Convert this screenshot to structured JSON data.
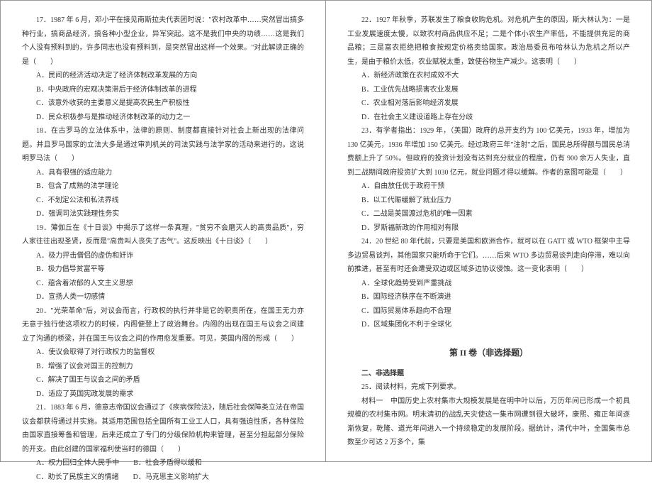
{
  "left": {
    "q17": {
      "stem": "17．1987 年 6 月，邓小平在接见南斯拉夫代表团时说：\"农村改革中……突然冒出搞多种行业，搞商品经济，搞各种小型企业，异军突起。这不是我们中央的功绩……这是我们个人没有预料到的，许多同志也没有预料到，是突然冒出这样一个效果。\"对此解读正确的是（　　）",
      "A": "A．民间的经济活动决定了经济体制改革发展的方向",
      "B": "B．中央政府的宏观决策滞后于经济体制改革的进程",
      "C": "C．该意外收获的主要意义是提高农民生产积极性",
      "D": "D．民众积极参与是推动经济体制改革的动力之一"
    },
    "q18": {
      "stem": "18．在古罗马的立法体系中，法律的原则、制度都直接针对社会上新出现的法律问题。并且罗马国家的立法大多是通过审判机关的司法实践与法学家的活动来进行的。这说明罗马法（　　）",
      "A": "A．具有很强的适应能力",
      "B": "B．包含了成熟的法学理论",
      "C": "C．不划定公法和私法界线",
      "D": "D．强调司法实践理性务实"
    },
    "q19": {
      "stem": "19．薄伽丘在《十日谈》中揭示了这样一条真理，\"贫穷不会磨灭人的高贵品质\"，穷人家往往出现圣贤，反而是\"高贵叫人丧失了志气\"。这反映出《十日谈》（　　）",
      "A": "A．极力抨击僧侣的虚伪和奸诈",
      "B": "B．极力倡导贫富平等",
      "C": "C．蕴含着浓郁的人文主义思想",
      "D": "D．宣扬人类一切感情"
    },
    "q20": {
      "stem": "20．\"光荣革命\"后，对议会而言，行政权的执行并非是它的职责所在，在国王无力亦无意于独行使这项权力的时候，内阁便登上了政治舞台。内阁的出现在国王与议会之间建立了沟通的桥梁，并在国王与议会之间的作用愈发重要。可见，英国内阁的形成（　　）",
      "A": "A．使议会取得了对行政权力的监督权",
      "B": "B．增强了议会对国王的控制力",
      "C": "C．解决了国王与议会之间的矛盾",
      "D": "D．适应了英国宪政发展的需求"
    },
    "q21": {
      "stem": "21．1883 年 6 月，德意志帝国议会通过了《疾病保险法》，随后社会保障类立法在帝国议会都获得通过并实施。其适用范围包括全国所有工业工人口，具有强迫性质，各种保险由国家直接筹备和管理，后来还成立了专门的分级保险机构来管理，甚至分担起部分保险的开支。由此创建的国家福利使当时的德国（　　）",
      "AB": "A．权力回归全体人民手中　　B．社会矛盾得以缓和",
      "CD": "C．助长了民族主义的情绪　　D．马克思主义影响扩大"
    }
  },
  "right": {
    "q22": {
      "stem": "22．1927 年秋季，苏联发生了粮食收购危机。对危机产生的原因，斯大林认为：一是工业发展速度太慢，以致农村商品供应不足；二是个体小农生产率低，不能提供充足的商品粮；三是富农拒绝把粮食按规定价格卖给国家。政治局委员布哈林认为危机之所以产生，是由于粮价太低，农业赋税太重，致使谷物生产减少。这表明（　　）",
      "A": "A．新经济政策在农村成效不大",
      "B": "B．工业优先战略损害农业发展",
      "C": "C．农业相对落后影响经济发展",
      "D": "D．在社会主义建设道路上存在分歧"
    },
    "q23": {
      "stem": "23．有学者指出：1929 年，（美国）政府的总开支约为 100 亿美元，1933 年，增加为 130 亿美元，1936 年增加 150 亿美元。经过政府三年\"注射\"之后，国民总所得额与国民总消费额上升了 50%。但政府的投资计划没有达到充分就业的程度，仍有 900 余万人失业，直到二战期间政府投资扩大到 1030 亿元，就业问题才得以缓解。作者的意图可能是（　　）",
      "A": "A．自由放任优于政府干预",
      "B": "B．以工代赈缓解了就业压力",
      "C": "C．二战是美国渡过危机的唯一因素",
      "D": "D．罗斯福新政的作用相对有限"
    },
    "q24": {
      "stem": "24．20 世纪 80 年代前，只要是美国和欧洲合作，就可以在 GATT 或 WTO 框架中主导多边贸易谈判，其他国家只能听命于它们。……后来 WTO 多边贸易谈判走向停滞，难以向前推进，甚至有时还会遭受双边或区域多边协议侵蚀。这一变化表明（　　）",
      "A": "A．全球化趋势受到严重挑战",
      "B": "B．国际经济秩序在不断演进",
      "C": "C．国际贸易体系趋向不合理",
      "D": "D．区域集团化不利于全球化"
    },
    "section2_title": "第 II 卷（非选择题）",
    "section2_sub": "二、非选择题",
    "q25_head": "25．阅读材料，完成下列要求。",
    "q25_m1": "材料一　中国历史上农村集市大规模发展是在明中叶以后，万历年间已形成一个初具规模的农村集市网。明末清初的战乱天灾使这一集市网遭到很大破坏，康熙、雍正年间逐渐恢复，乾隆、道光年间进入一个持续稳定的发展阶段。据统计，清代中叶，全国集市总数至少可达 2 万多个，集"
  }
}
